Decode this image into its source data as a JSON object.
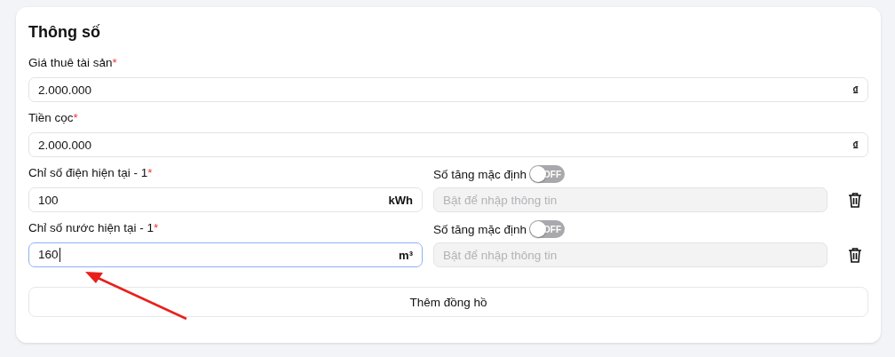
{
  "title": "Thông số",
  "fields": [
    {
      "label": "Giá thuê tài sản",
      "required_mark": "*",
      "value": "2.000.000",
      "unit": "₫"
    },
    {
      "label": "Tiền cọc",
      "required_mark": "*",
      "value": "2.000.000",
      "unit": "₫"
    }
  ],
  "meters": [
    {
      "label": "Chỉ số điện hiện tại - 1",
      "required_mark": "*",
      "value": "100",
      "unit": "kWh",
      "focused": false,
      "increment_label": "Số tăng mặc định",
      "toggle": {
        "on": false,
        "text": "OFF"
      },
      "increment_placeholder": "Bật để nhập thông tin"
    },
    {
      "label": "Chỉ số nước hiện tại - 1",
      "required_mark": "*",
      "value": "160",
      "unit": "m³",
      "focused": true,
      "increment_label": "Số tăng mặc định",
      "toggle": {
        "on": false,
        "text": "OFF"
      },
      "increment_placeholder": "Bật để nhập thông tin"
    }
  ],
  "add_button": "Thêm đồng hồ"
}
